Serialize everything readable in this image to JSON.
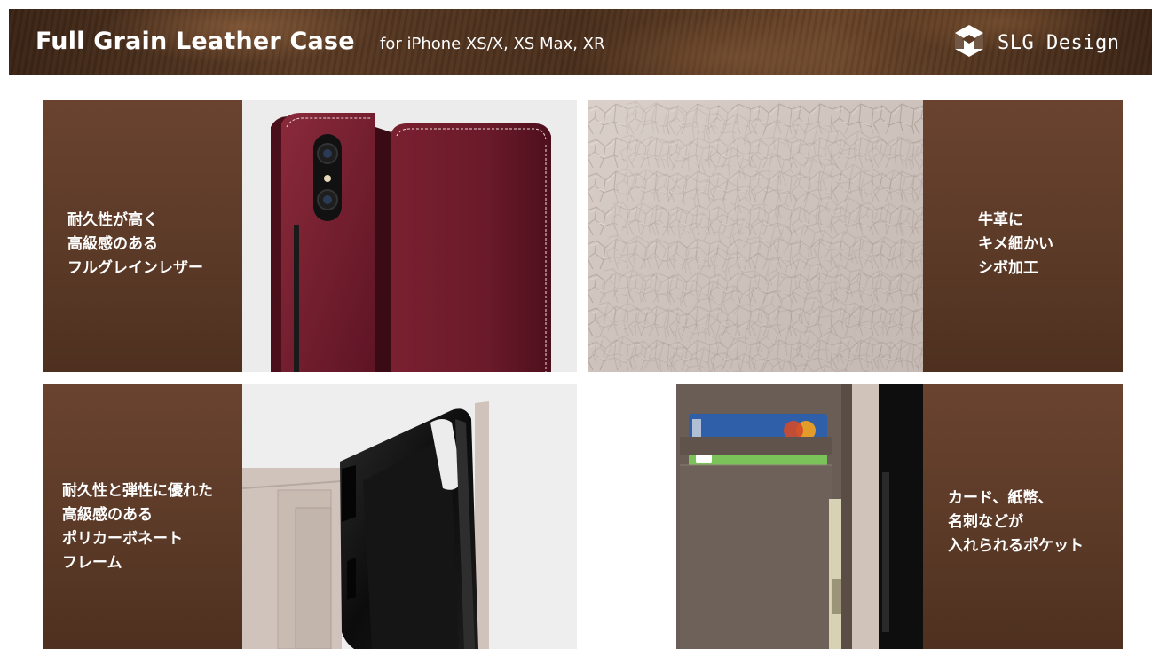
{
  "header": {
    "title": "Full Grain Leather Case",
    "subtitle": "for iPhone XS/X, XS Max, XR",
    "brand": "SLG Design",
    "brand_logo_icon": "slg-cube-logo-icon"
  },
  "features": [
    {
      "lines": [
        "耐久性が高く",
        "高級感のある",
        "フルグレインレザー"
      ],
      "image_icon": "burgundy-leather-case-photo"
    },
    {
      "lines": [
        "牛革に",
        "キメ細かい",
        "シボ加工"
      ],
      "image_icon": "leather-grain-texture-photo"
    },
    {
      "lines": [
        "耐久性と弾性に優れた",
        "高級感のある",
        "ポリカーボネート",
        "フレーム"
      ],
      "image_icon": "polycarbonate-frame-photo"
    },
    {
      "lines": [
        "カード、紙幣、",
        "名刺などが",
        "入れられるポケット"
      ],
      "image_icon": "card-pocket-photo"
    }
  ],
  "colors": {
    "panel_brown": "#5b3a27",
    "leather_burgundy": "#6e1b2c",
    "leather_greige": "#d7cbc4",
    "leather_taupe": "#6a5d55"
  }
}
